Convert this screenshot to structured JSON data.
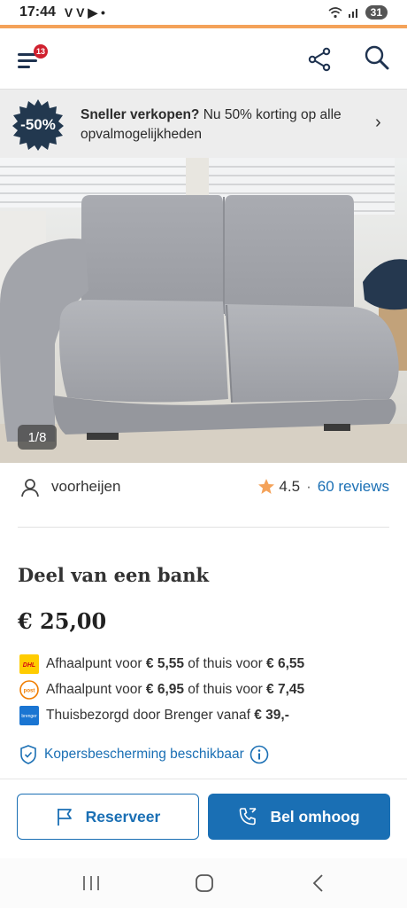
{
  "status_bar": {
    "time": "17:44",
    "notifications": "V V ▶ •",
    "battery": "31"
  },
  "header": {
    "menu_badge": "13"
  },
  "promo": {
    "badge": "-50%",
    "bold": "Sneller verkopen?",
    "text": " Nu 50% korting op alle opvalmogelijkheden"
  },
  "photo": {
    "counter": "1/8"
  },
  "seller": {
    "name": "voorheijen",
    "rating": "4.5",
    "separator": "·",
    "reviews": "60 reviews"
  },
  "listing": {
    "title": "Deel van een bank",
    "price": "€ 25,00"
  },
  "shipping": [
    {
      "icon": "dhl-icon",
      "pre": "Afhaalpunt voor ",
      "price1": "€ 5,55",
      "mid": " of thuis voor ",
      "price2": "€ 6,55"
    },
    {
      "icon": "postnl-icon",
      "pre": "Afhaalpunt voor ",
      "price1": "€ 6,95",
      "mid": " of thuis voor ",
      "price2": "€ 7,45"
    },
    {
      "icon": "brenger-icon",
      "pre": "Thuisbezorgd door Brenger vanaf ",
      "price1": "€ 39,-",
      "mid": "",
      "price2": ""
    }
  ],
  "protection": {
    "label": "Kopersbescherming beschikbaar"
  },
  "actions": {
    "reserve": "Reserveer",
    "call": "Bel omhoog"
  },
  "colors": {
    "accent": "#f4a259",
    "primary": "#1a6fb4",
    "badge_red": "#d0202e",
    "star": "#f4a259"
  }
}
